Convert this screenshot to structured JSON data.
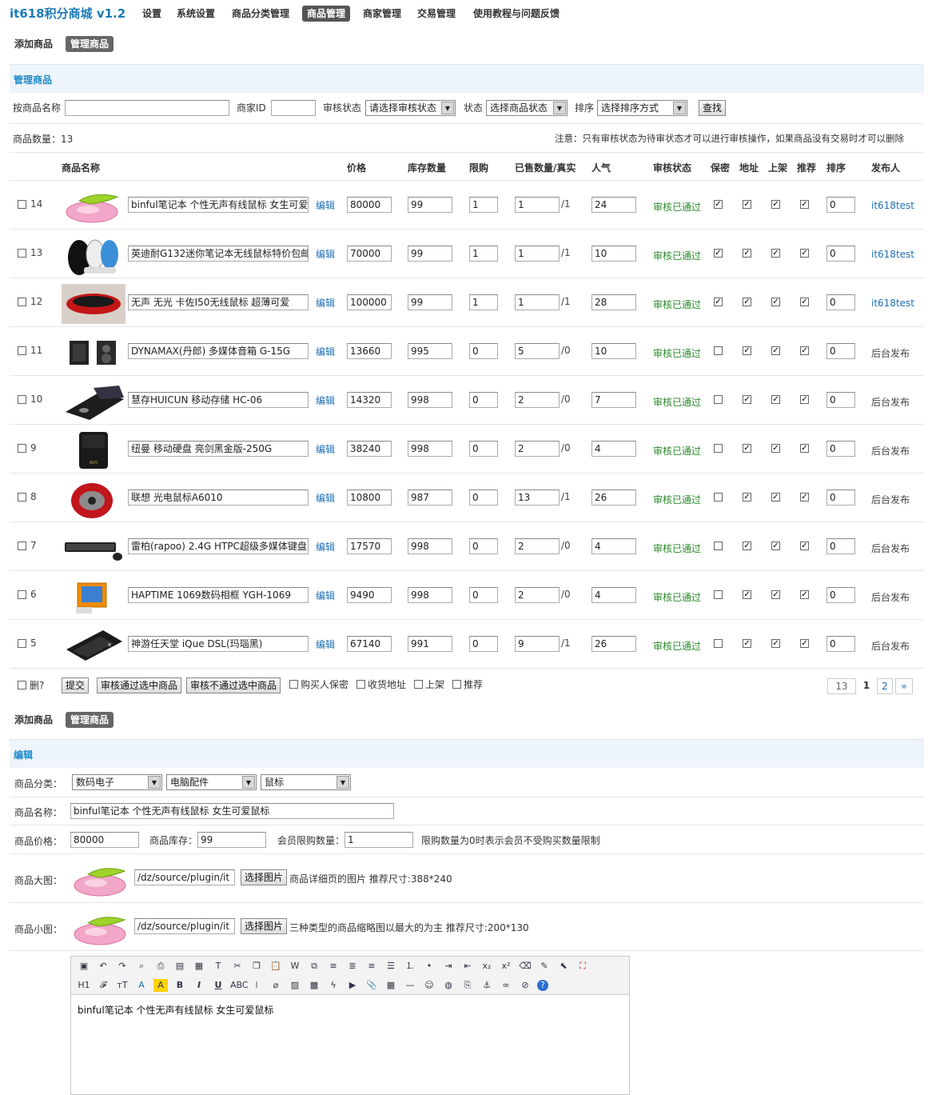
{
  "brand": "it618积分商城 v1.2",
  "topnav": [
    "设置",
    "系统设置",
    "商品分类管理",
    "商品管理",
    "商家管理",
    "交易管理",
    "使用教程与问题反馈"
  ],
  "subnav": {
    "add": "添加商品",
    "manage": "管理商品"
  },
  "panel_title": "管理商品",
  "filter": {
    "name_label": "按商品名称",
    "shop_label": "商家ID",
    "audit_label": "审核状态",
    "audit_value": "请选择审核状态",
    "status_label": "状态",
    "status_value": "选择商品状态",
    "sort_label": "排序",
    "sort_value": "选择排序方式",
    "search_btn": "查找"
  },
  "count_text": "商品数量：13",
  "notice": "注意：只有审核状态为待审状态才可以进行审核操作，如果商品没有交易时才可以删除",
  "columns": [
    "商品名称",
    "价格",
    "库存数量",
    "限购",
    "已售数量/真实",
    "人气",
    "审核状态",
    "保密",
    "地址",
    "上架",
    "推荐",
    "排序",
    "发布人"
  ],
  "products": [
    {
      "id": "14",
      "name": "binful笔记本 个性无声有线鼠标 女生可爱",
      "price": "80000",
      "stock": "99",
      "limit": "1",
      "sold": "1",
      "real": "/1",
      "pop": "24",
      "audit": "审核已通过",
      "secret": true,
      "addr": true,
      "shelf": true,
      "rec": true,
      "order": "0",
      "publisher": "it618test",
      "thumb": "mouse-pink"
    },
    {
      "id": "13",
      "name": "英迪耐G132迷你笔记本无线鼠标特价包邮",
      "price": "70000",
      "stock": "99",
      "limit": "1",
      "sold": "1",
      "real": "/1",
      "pop": "10",
      "audit": "审核已通过",
      "secret": true,
      "addr": true,
      "shelf": true,
      "rec": true,
      "order": "0",
      "publisher": "it618test",
      "thumb": "mouse-set"
    },
    {
      "id": "12",
      "name": "无声 无光 卡佐I50无线鼠标 超薄可爱",
      "price": "100000",
      "stock": "99",
      "limit": "1",
      "sold": "1",
      "real": "/1",
      "pop": "28",
      "audit": "审核已通过",
      "secret": true,
      "addr": true,
      "shelf": true,
      "rec": true,
      "order": "0",
      "publisher": "it618test",
      "thumb": "mouse-red"
    },
    {
      "id": "11",
      "name": "DYNAMAX(丹郎) 多媒体音箱 G-15G",
      "price": "13660",
      "stock": "995",
      "limit": "0",
      "sold": "5",
      "real": "/0",
      "pop": "10",
      "audit": "审核已通过",
      "secret": false,
      "addr": true,
      "shelf": true,
      "rec": true,
      "order": "0",
      "publisher": "后台发布",
      "thumb": "speakers"
    },
    {
      "id": "10",
      "name": "慧存HUICUN 移动存储 HC-06",
      "price": "14320",
      "stock": "998",
      "limit": "0",
      "sold": "2",
      "real": "/0",
      "pop": "7",
      "audit": "审核已通过",
      "secret": false,
      "addr": true,
      "shelf": true,
      "rec": true,
      "order": "0",
      "publisher": "后台发布",
      "thumb": "storage"
    },
    {
      "id": "9",
      "name": "纽曼 移动硬盘 亮剑黑金版-250G",
      "price": "38240",
      "stock": "998",
      "limit": "0",
      "sold": "2",
      "real": "/0",
      "pop": "4",
      "audit": "审核已通过",
      "secret": false,
      "addr": true,
      "shelf": true,
      "rec": true,
      "order": "0",
      "publisher": "后台发布",
      "thumb": "hdd"
    },
    {
      "id": "8",
      "name": "联想 光电鼠标A6010",
      "price": "10800",
      "stock": "987",
      "limit": "0",
      "sold": "13",
      "real": "/1",
      "pop": "26",
      "audit": "审核已通过",
      "secret": false,
      "addr": true,
      "shelf": true,
      "rec": true,
      "order": "0",
      "publisher": "后台发布",
      "thumb": "mouse-lenovo"
    },
    {
      "id": "7",
      "name": "雷柏(rapoo) 2.4G HTPC超级多媒体键盘",
      "price": "17570",
      "stock": "998",
      "limit": "0",
      "sold": "2",
      "real": "/0",
      "pop": "4",
      "audit": "审核已通过",
      "secret": false,
      "addr": true,
      "shelf": true,
      "rec": true,
      "order": "0",
      "publisher": "后台发布",
      "thumb": "keyboard"
    },
    {
      "id": "6",
      "name": "HAPTIME 1069数码相框 YGH-1069",
      "price": "9490",
      "stock": "998",
      "limit": "0",
      "sold": "2",
      "real": "/0",
      "pop": "4",
      "audit": "审核已通过",
      "secret": false,
      "addr": true,
      "shelf": true,
      "rec": true,
      "order": "0",
      "publisher": "后台发布",
      "thumb": "photo-frame"
    },
    {
      "id": "5",
      "name": "神游任天堂 iQue DSL(玛瑙黑)",
      "price": "67140",
      "stock": "991",
      "limit": "0",
      "sold": "9",
      "real": "/1",
      "pop": "26",
      "audit": "审核已通过",
      "secret": false,
      "addr": true,
      "shelf": true,
      "rec": true,
      "order": "0",
      "publisher": "后台发布",
      "thumb": "game-console"
    }
  ],
  "batch": {
    "del": "删?",
    "submit": "提交",
    "approve": "审核通过选中商品",
    "reject": "审核不通过选中商品",
    "opt1": "购买人保密",
    "opt2": "收货地址",
    "opt3": "上架",
    "opt4": "推荐"
  },
  "pager": {
    "total": "13",
    "current": "1",
    "next": "2",
    "more": "»"
  },
  "edit": {
    "title": "编辑",
    "cat_label": "商品分类：",
    "cat1": "数码电子",
    "cat2": "电脑配件",
    "cat3": "鼠标",
    "name_label": "商品名称：",
    "name_value": "binful笔记本 个性无声有线鼠标 女生可爱鼠标",
    "price_label": "商品价格：",
    "price_value": "80000",
    "stock_label": "商品库存：",
    "stock_value": "99",
    "limit_label": "会员限购数量：",
    "limit_value": "1",
    "limit_hint": "限购数量为0时表示会员不受购买数量限制",
    "bigimg_label": "商品大图：",
    "bigimg_path": "/dz/source/plugin/it",
    "bigimg_btn": "选择图片",
    "bigimg_hint": "商品详细页的图片 推荐尺寸:388*240",
    "smallimg_label": "商品小图：",
    "smallimg_path": "/dz/source/plugin/it",
    "smallimg_btn": "选择图片",
    "smallimg_hint": "三种类型的商品缩略图以最大的为主 推荐尺寸:200*130",
    "content": "binful笔记本 个性无声有线鼠标 女生可爱鼠标"
  },
  "toolbar1": [
    "source-icon",
    "undo-icon",
    "redo-icon",
    "preview-icon",
    "print-icon",
    "template-icon",
    "select-all-icon",
    "paste-text-icon",
    "cut-icon",
    "copy-icon",
    "paste-icon",
    "paste-word-icon",
    "paste-html-icon",
    "align-left-icon",
    "align-center-icon",
    "align-right-icon",
    "align-justify-icon",
    "ordered-list-icon",
    "unordered-list-icon",
    "indent-icon",
    "outdent-icon",
    "subscript-icon",
    "superscript-icon",
    "clear-format-icon",
    "quick-format-icon",
    "select-icon",
    "fullscreen-icon"
  ],
  "toolbar2": [
    "heading-icon",
    "font-family-icon",
    "font-size-icon",
    "font-color-icon",
    "highlight-icon",
    "bold-icon",
    "italic-icon",
    "underline-icon",
    "strikethrough-icon",
    "line-height-icon",
    "remove-format-icon",
    "image-icon",
    "multi-image-icon",
    "flash-icon",
    "media-icon",
    "attachment-icon",
    "table-icon",
    "hr-icon",
    "emoticon-icon",
    "baidu-map-icon",
    "page-break-icon",
    "anchor-icon",
    "link-icon",
    "unlink-icon",
    "about-icon"
  ]
}
